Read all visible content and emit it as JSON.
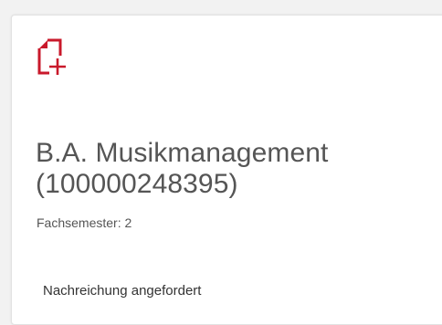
{
  "card": {
    "icon": "document-add-icon",
    "icon_color": "#c9192b",
    "title_line1": "B.A. Musikmanagement",
    "title_line2": "(100000248395)",
    "semester": "Fachsemester: 2",
    "status": "Nachreichung angefordert"
  }
}
